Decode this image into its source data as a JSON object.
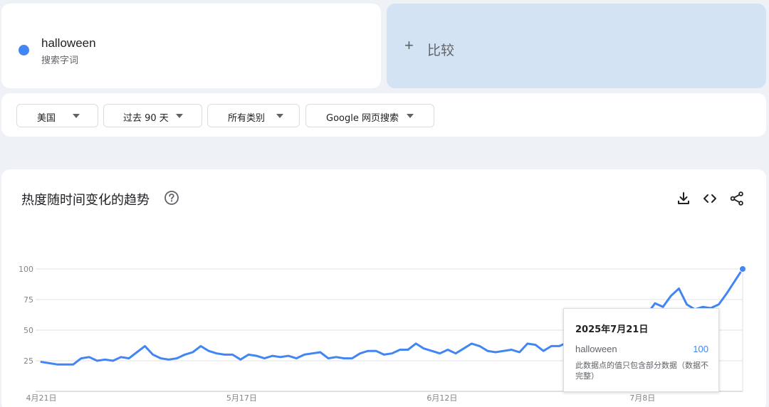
{
  "search_term": {
    "name": "halloween",
    "type_label": "搜索字词",
    "color": "#4285f4"
  },
  "compare": {
    "plus": "+",
    "label": "比较",
    "background": "#d3e3f4"
  },
  "filters": {
    "region": "美国",
    "time_range": "过去 90 天",
    "category": "所有类别",
    "search_type": "Google 网页搜索"
  },
  "chart_card": {
    "title": "热度随时间变化的趋势",
    "icons": [
      "help-icon",
      "download-icon",
      "embed-code-icon",
      "share-icon"
    ]
  },
  "tooltip": {
    "date": "2025年7月21日",
    "term": "halloween",
    "value": "100",
    "note": "此数据点的值只包含部分数据（数据不完整）"
  },
  "chart_data": {
    "type": "line",
    "title": "热度随时间变化的趋势",
    "xlabel": "",
    "ylabel": "",
    "ylim": [
      0,
      100
    ],
    "y_ticks": [
      25,
      50,
      75,
      100
    ],
    "x_start": "2025-04-21",
    "x_end": "2025-07-21",
    "x_ticks": [
      {
        "label": "4月21日",
        "date": "2025-04-21"
      },
      {
        "label": "5月17日",
        "date": "2025-05-17"
      },
      {
        "label": "6月12日",
        "date": "2025-06-12"
      },
      {
        "label": "7月8日",
        "date": "2025-07-08"
      }
    ],
    "grid": true,
    "series": [
      {
        "name": "halloween",
        "color": "#4285f4",
        "values": [
          24,
          23,
          22,
          22,
          22,
          27,
          28,
          25,
          26,
          25,
          28,
          27,
          32,
          37,
          30,
          27,
          26,
          27,
          30,
          32,
          37,
          33,
          31,
          30,
          30,
          26,
          30,
          29,
          27,
          29,
          28,
          29,
          27,
          30,
          31,
          32,
          27,
          28,
          27,
          27,
          31,
          33,
          33,
          30,
          31,
          34,
          34,
          39,
          35,
          33,
          31,
          34,
          31,
          35,
          39,
          37,
          33,
          32,
          33,
          34,
          32,
          39,
          38,
          33,
          37,
          37,
          40,
          38,
          46,
          44,
          41,
          39,
          43,
          48,
          55,
          60,
          63,
          72,
          69,
          78,
          84,
          71,
          67,
          69,
          68,
          71,
          80,
          90,
          100
        ]
      }
    ],
    "highlight": {
      "date": "2025-07-21",
      "value": 100
    }
  }
}
